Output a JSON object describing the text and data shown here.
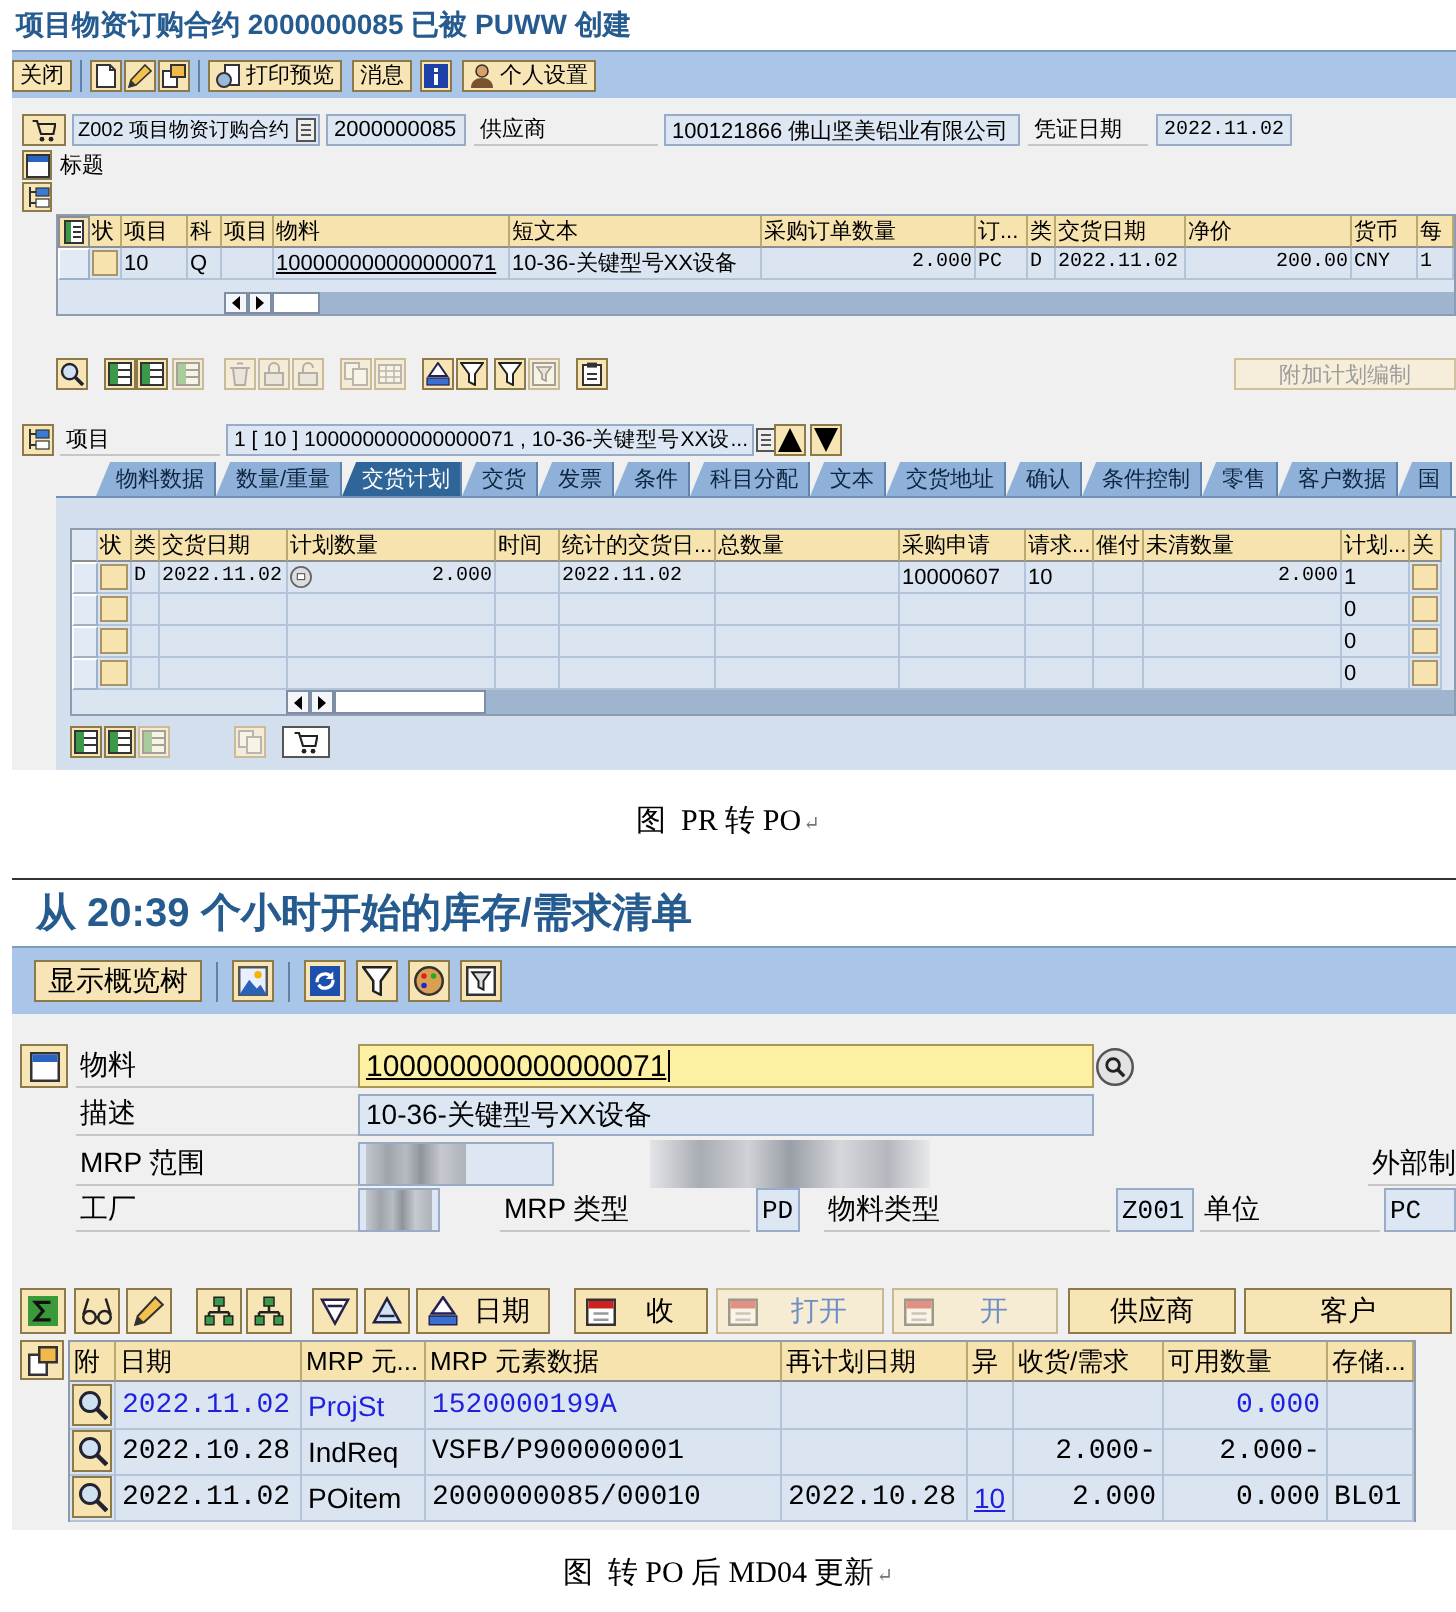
{
  "pr_to_po": {
    "title": "项目物资订购合约 2000000085 已被 PUWW 创建",
    "toolbar": [
      "关闭",
      "打印预览",
      "消息",
      "个人设置"
    ],
    "header": {
      "order_type": "Z002 项目物资订购合约",
      "order_number": "2000000085",
      "vendor_label": "供应商",
      "vendor": "100121866 佛山坚美铝业有限公司",
      "date_label": "凭证日期",
      "date": "2022.11.02",
      "section_label": "标题"
    },
    "items_table": {
      "columns": [
        {
          "label": "状",
          "kind": "status"
        },
        {
          "label": "项目",
          "kind": "text"
        },
        {
          "label": "科",
          "kind": "text"
        },
        {
          "label": "项目",
          "kind": "text"
        },
        {
          "label": "物料",
          "kind": "link"
        },
        {
          "label": "短文本",
          "kind": "text"
        },
        {
          "label": "采购订单数量",
          "kind": "num"
        },
        {
          "label": "订...",
          "kind": "mono"
        },
        {
          "label": "类",
          "kind": "mono"
        },
        {
          "label": "交货日期",
          "kind": "mono"
        },
        {
          "label": "净价",
          "kind": "num"
        },
        {
          "label": "货币",
          "kind": "mono"
        },
        {
          "label": "每",
          "kind": "mono"
        }
      ],
      "rows": [
        {
          "cells": [
            null,
            "10",
            "Q",
            null,
            "100000000000000071",
            "10-36-关键型号XX设备",
            "2.000",
            "PC",
            "D",
            "2022.11.02",
            "200.00",
            "CNY",
            "1"
          ]
        }
      ]
    },
    "item_toolbar": {
      "icons": [
        {
          "disabled": false
        },
        {
          "disabled": false
        },
        {
          "disabled": false
        },
        {
          "disabled": true
        },
        {
          "disabled": true
        },
        {
          "disabled": true
        },
        {
          "disabled": true
        },
        {
          "disabled": true
        },
        {
          "disabled": true
        },
        {
          "disabled": false
        },
        {
          "disabled": false
        },
        {
          "disabled": false
        },
        {
          "disabled": true
        },
        {
          "disabled": false
        }
      ],
      "extra_button": {
        "label": "附加计划编制",
        "disabled": true
      }
    },
    "item_selector": {
      "label": "项目",
      "value": "1 [ 10 ] 100000000000000071 , 10-36-关键型号XX设..."
    },
    "tabs": [
      {
        "label": "物料数据",
        "selected": false
      },
      {
        "label": "数量/重量",
        "selected": false
      },
      {
        "label": "交货计划",
        "selected": true
      },
      {
        "label": "交货",
        "selected": false
      },
      {
        "label": "发票",
        "selected": false
      },
      {
        "label": "条件",
        "selected": false
      },
      {
        "label": "科目分配",
        "selected": false
      },
      {
        "label": "文本",
        "selected": false
      },
      {
        "label": "交货地址",
        "selected": false
      },
      {
        "label": "确认",
        "selected": false
      },
      {
        "label": "条件控制",
        "selected": false
      },
      {
        "label": "零售",
        "selected": false
      },
      {
        "label": "客户数据",
        "selected": false
      },
      {
        "label": "国",
        "selected": false
      }
    ],
    "schedule_table": {
      "columns": [
        {
          "label": "状",
          "kind": "status"
        },
        {
          "label": "类",
          "kind": "mono"
        },
        {
          "label": "交货日期",
          "kind": "mono"
        },
        {
          "label": "计划数量",
          "kind": "qty"
        },
        {
          "label": "时间",
          "kind": "text"
        },
        {
          "label": "统计的交货日...",
          "kind": "mono"
        },
        {
          "label": "总数量",
          "kind": "num"
        },
        {
          "label": "采购申请",
          "kind": "text"
        },
        {
          "label": "请求...",
          "kind": "text"
        },
        {
          "label": "催付",
          "kind": "text"
        },
        {
          "label": "未清数量",
          "kind": "num"
        },
        {
          "label": "计划...",
          "kind": "text"
        },
        {
          "label": "关",
          "kind": "status"
        }
      ],
      "rows": [
        {
          "cells": [
            null,
            "D",
            "2022.11.02",
            "2.000",
            null,
            "2022.11.02",
            null,
            "10000607",
            "10",
            null,
            "2.000",
            "1",
            null
          ]
        },
        {
          "cells": [
            null,
            null,
            null,
            null,
            null,
            null,
            null,
            null,
            null,
            null,
            null,
            "0",
            null
          ]
        },
        {
          "cells": [
            null,
            null,
            null,
            null,
            null,
            null,
            null,
            null,
            null,
            null,
            null,
            "0",
            null
          ]
        },
        {
          "cells": [
            null,
            null,
            null,
            null,
            null,
            null,
            null,
            null,
            null,
            null,
            null,
            "0",
            null
          ]
        }
      ]
    },
    "panel_icons": [
      {
        "disabled": false
      },
      {
        "disabled": false
      },
      {
        "disabled": true
      },
      {
        "disabled": true
      },
      {
        "disabled": false
      }
    ]
  },
  "caption_1": {
    "text": "图  PR 转 PO",
    "paragraph_mark": "↵"
  },
  "md04": {
    "title": "从 20:39 个小时开始的库存/需求清单",
    "overview_button": "显示概览树",
    "fields": {
      "material": {
        "label": "物料",
        "value": "100000000000000071",
        "focused": true
      },
      "description": {
        "label": "描述",
        "value": "10-36-关键型号XX设备"
      },
      "mrp_area": {
        "label": "MRP 范围",
        "redacted": true
      },
      "plant": {
        "label": "工厂",
        "redacted": true
      },
      "mrp_type": {
        "label": "MRP 类型",
        "value": "PD"
      },
      "material_type": {
        "label": "物料类型",
        "value": "Z001"
      },
      "unit": {
        "label": "单位",
        "value": "PC"
      }
    },
    "external_label": "外部制",
    "view_buttons": [
      {
        "label": "日期",
        "disabled": false
      },
      {
        "label": "收",
        "disabled": false
      },
      {
        "label": "打开",
        "disabled": true
      },
      {
        "label": "开",
        "disabled": true
      },
      {
        "label": "供应商",
        "disabled": false
      },
      {
        "label": "客户",
        "disabled": false
      }
    ],
    "table": {
      "columns": [
        {
          "label": "附",
          "kind": "find"
        },
        {
          "label": "日期",
          "kind": "mono"
        },
        {
          "label": "MRP 元...",
          "kind": "text"
        },
        {
          "label": "MRP 元素数据",
          "kind": "mono"
        },
        {
          "label": "再计划日期",
          "kind": "mono"
        },
        {
          "label": "异",
          "kind": "link"
        },
        {
          "label": "收货/需求",
          "kind": "num"
        },
        {
          "label": "可用数量",
          "kind": "num"
        },
        {
          "label": "存储...",
          "kind": "mono"
        }
      ],
      "rows": [
        {
          "highlighted": true,
          "cells": [
            null,
            "2022.11.02",
            "ProjSt",
            "1520000199A",
            null,
            null,
            null,
            "0.000",
            null
          ]
        },
        {
          "highlighted": false,
          "cells": [
            null,
            "2022.10.28",
            "IndReq",
            "VSFB/P900000001",
            null,
            null,
            "2.000-",
            "2.000-",
            null
          ]
        },
        {
          "highlighted": false,
          "cells": [
            null,
            "2022.11.02",
            "POitem",
            "2000000085/00010",
            "2022.10.28",
            "10",
            "2.000",
            "0.000",
            "BL01"
          ]
        }
      ]
    }
  },
  "caption_2": {
    "text": "图  转 PO 后 MD04 更新",
    "paragraph_mark": "↵"
  }
}
